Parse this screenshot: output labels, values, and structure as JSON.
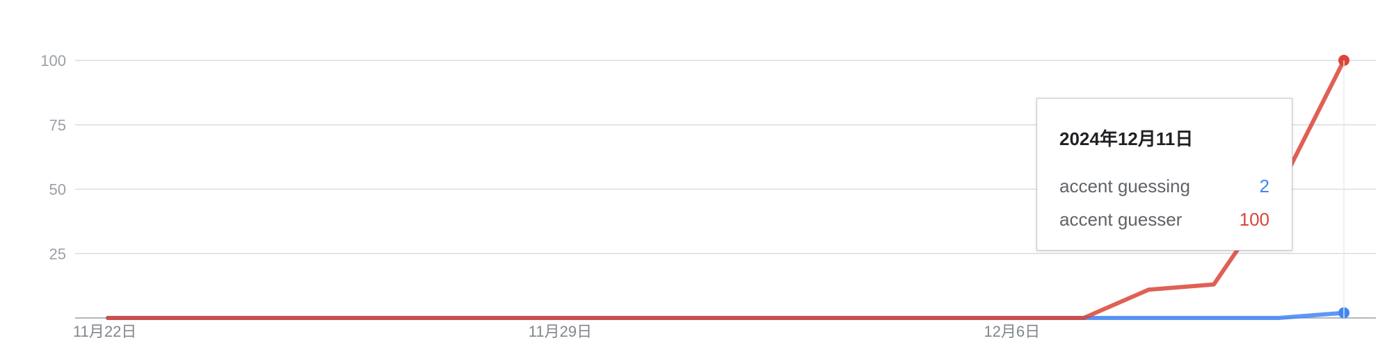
{
  "chart_data": {
    "type": "line",
    "x": [
      "2024-11-22",
      "2024-11-23",
      "2024-11-24",
      "2024-11-25",
      "2024-11-26",
      "2024-11-27",
      "2024-11-28",
      "2024-11-29",
      "2024-11-30",
      "2024-12-01",
      "2024-12-02",
      "2024-12-03",
      "2024-12-04",
      "2024-12-05",
      "2024-12-06",
      "2024-12-07",
      "2024-12-08",
      "2024-12-09",
      "2024-12-10",
      "2024-12-11"
    ],
    "series": [
      {
        "name": "accent guessing",
        "color": "#4285f4",
        "values": [
          0,
          0,
          0,
          0,
          0,
          0,
          0,
          0,
          0,
          0,
          0,
          0,
          0,
          0,
          0,
          0,
          0,
          0,
          0,
          2
        ]
      },
      {
        "name": "accent guesser",
        "color": "#db4437",
        "values": [
          0,
          0,
          0,
          0,
          0,
          0,
          0,
          0,
          0,
          0,
          0,
          0,
          0,
          0,
          0,
          0,
          11,
          13,
          50,
          100
        ]
      }
    ],
    "ylim": [
      0,
      100
    ],
    "yticks": [
      "25",
      "50",
      "75",
      "100"
    ],
    "xtick_labels": [
      {
        "date": "2024-11-22",
        "label": "11月22日"
      },
      {
        "date": "2024-11-29",
        "label": "11月29日"
      },
      {
        "date": "2024-12-06",
        "label": "12月6日"
      }
    ],
    "grid": true,
    "tooltip": {
      "date": "2024年12月11日",
      "rows": [
        {
          "label": "accent guessing",
          "value": "2",
          "color": "#4285f4"
        },
        {
          "label": "accent guesser",
          "value": "100",
          "color": "#db4437"
        }
      ]
    }
  }
}
